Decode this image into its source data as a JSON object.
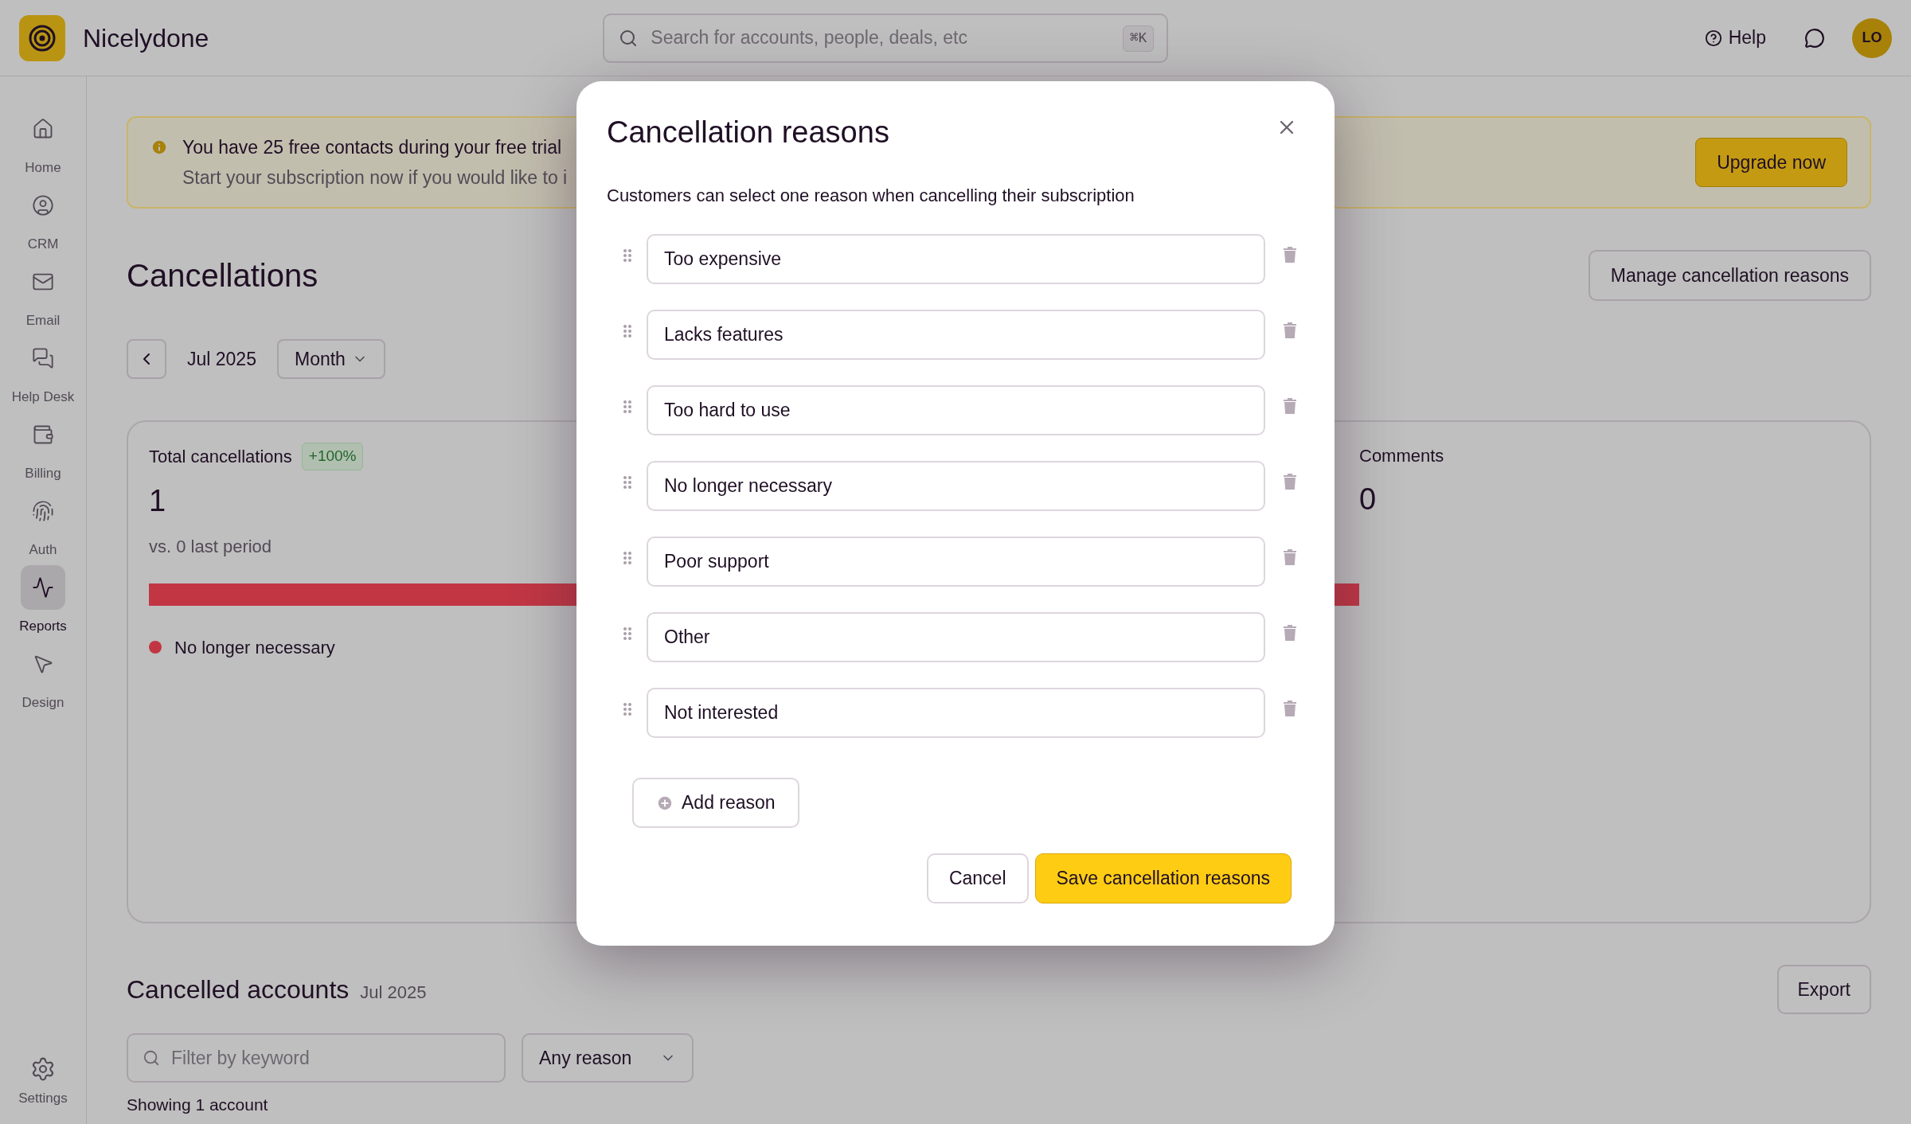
{
  "app": {
    "name": "Nicelydone"
  },
  "search": {
    "placeholder": "Search for accounts, people, deals, etc",
    "shortcut": "⌘K"
  },
  "header": {
    "help": "Help",
    "avatar": "LO"
  },
  "nav": [
    {
      "label": "Home",
      "selected": false
    },
    {
      "label": "CRM",
      "selected": false
    },
    {
      "label": "Email",
      "selected": false
    },
    {
      "label": "Help Desk",
      "selected": false
    },
    {
      "label": "Billing",
      "selected": false
    },
    {
      "label": "Auth",
      "selected": false
    },
    {
      "label": "Reports",
      "selected": true
    },
    {
      "label": "Design",
      "selected": false
    }
  ],
  "settings": {
    "label": "Settings"
  },
  "banner": {
    "title": "You have 25 free contacts during your free trial",
    "text": "Start your subscription now if you would like to i",
    "button": "Upgrade now"
  },
  "page": {
    "title": "Cancellations",
    "manage_button": "Manage cancellation reasons",
    "period": "Jul 2025",
    "granularity": "Month"
  },
  "total": {
    "label": "Total cancellations",
    "change": "+100%",
    "value": "1",
    "comparison": "vs. 0 last period",
    "legend": [
      {
        "label": "No longer necessary",
        "color": "#c23644"
      }
    ]
  },
  "comments": {
    "label": "Comments",
    "value": "0"
  },
  "accounts": {
    "title": "Cancelled accounts",
    "period": "Jul 2025",
    "export": "Export",
    "filter_placeholder": "Filter by keyword",
    "reason_filter": "Any reason",
    "count": "Showing 1 account"
  },
  "modal": {
    "title": "Cancellation reasons",
    "description": "Customers can select one reason when cancelling their subscription",
    "reasons": [
      "Too expensive",
      "Lacks features",
      "Too hard to use",
      "No longer necessary",
      "Poor support",
      "Other",
      "Not interested"
    ],
    "add": "Add reason",
    "cancel": "Cancel",
    "save": "Save cancellation reasons"
  }
}
